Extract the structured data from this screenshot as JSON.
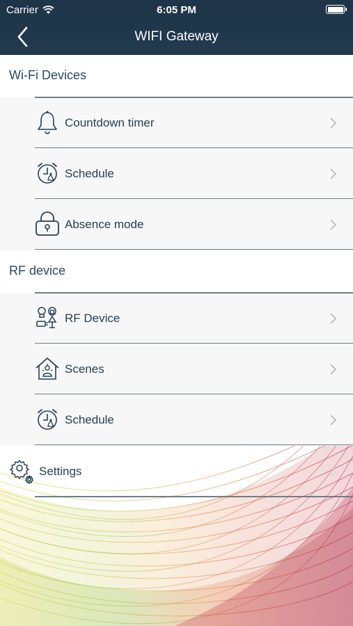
{
  "status_bar": {
    "carrier": "Carrier",
    "time": "6:05 PM"
  },
  "nav": {
    "title": "WIFI Gateway",
    "back_icon": "chevron-left-icon"
  },
  "sections": [
    {
      "title": "Wi-Fi Devices",
      "items": [
        {
          "label": "Countdown timer",
          "icon": "bell-icon"
        },
        {
          "label": "Schedule",
          "icon": "alarm-clock-icon"
        },
        {
          "label": "Absence mode",
          "icon": "lock-icon"
        }
      ]
    },
    {
      "title": "RF device",
      "items": [
        {
          "label": "RF Device",
          "icon": "rf-devices-icon"
        },
        {
          "label": "Scenes",
          "icon": "house-scene-icon"
        },
        {
          "label": "Schedule",
          "icon": "alarm-clock-icon"
        }
      ]
    }
  ],
  "settings": {
    "label": "Settings",
    "icon": "gears-icon"
  },
  "colors": {
    "nav_bg": "#223a4f",
    "text": "#253f57",
    "divider": "#6f7d88",
    "row_bg": "#f7f7f7"
  }
}
